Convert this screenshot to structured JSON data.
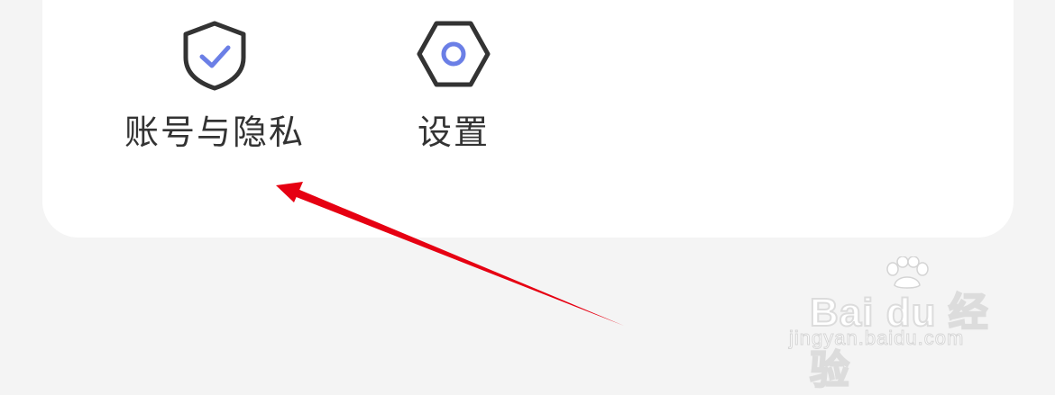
{
  "menu": {
    "items": [
      {
        "label": "账号与隐私",
        "icon": "shield-check-icon"
      },
      {
        "label": "设置",
        "icon": "hexagon-settings-icon"
      }
    ]
  },
  "colors": {
    "accent": "#6b7fe6",
    "icon_outline": "#333333",
    "arrow": "#e60012",
    "background": "#f4f4f4",
    "card": "#ffffff"
  },
  "watermark": {
    "brand": "Bai du 经验",
    "url": "jingyan.baidu.com"
  }
}
